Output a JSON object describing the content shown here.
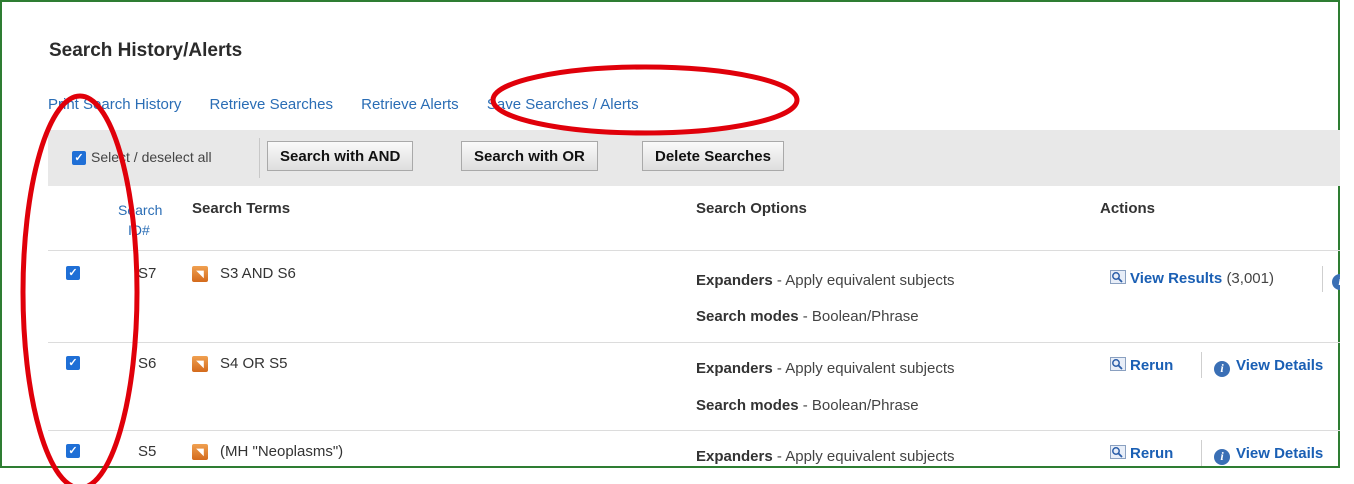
{
  "panel": {
    "title": "Search History/Alerts"
  },
  "links": [
    "Print Search History",
    "Retrieve Searches",
    "Retrieve Alerts",
    "Save Searches / Alerts"
  ],
  "toolbar": {
    "select_all_label": "Select / deselect all",
    "btn_and": "Search with AND",
    "btn_or": "Search with OR",
    "btn_delete": "Delete Searches"
  },
  "table": {
    "headers": {
      "search_id_line1": "Search",
      "search_id_line2": "ID#",
      "terms": "Search Terms",
      "options": "Search Options",
      "actions": "Actions"
    },
    "rows": [
      {
        "id": "S7",
        "terms": "S3 AND S6",
        "expanders_label": "Expanders",
        "expanders_value": "Apply equivalent subjects",
        "modes_label": "Search modes",
        "modes_value": "Boolean/Phrase",
        "action_primary": "View Results",
        "result_count": "(3,001)"
      },
      {
        "id": "S6",
        "terms": "S4 OR S5",
        "expanders_label": "Expanders",
        "expanders_value": "Apply equivalent subjects",
        "modes_label": "Search modes",
        "modes_value": "Boolean/Phrase",
        "action_primary": "Rerun",
        "action_secondary": "View Details"
      },
      {
        "id": "S5",
        "terms": "(MH \"Neoplasms\")",
        "expanders_label": "Expanders",
        "expanders_value": "Apply equivalent subjects",
        "action_primary": "Rerun",
        "action_secondary": "View Details"
      }
    ]
  },
  "colors": {
    "frame_border": "#2e7d32",
    "link": "#2a6db5",
    "checkbox": "#1f6fd6",
    "annotation": "#e0000a"
  },
  "icons": [
    "checkbox-checked-icon",
    "rss-icon",
    "magnifier-icon",
    "info-icon"
  ]
}
